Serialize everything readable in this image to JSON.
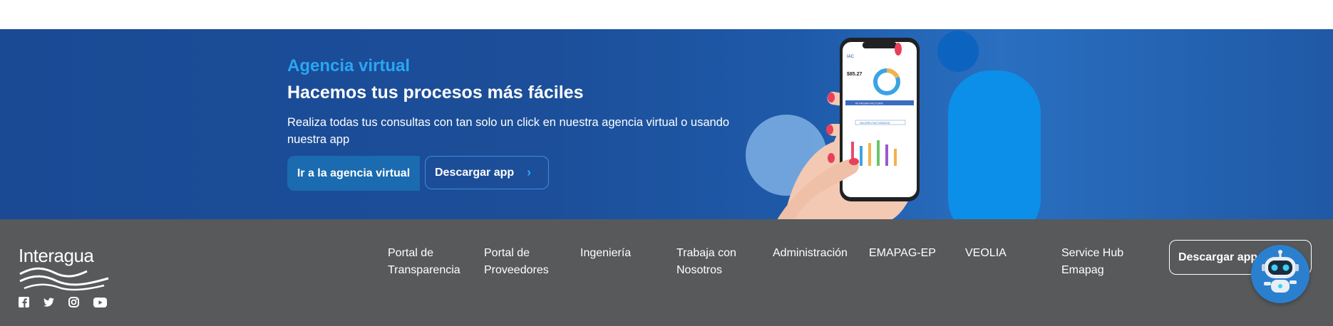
{
  "banner": {
    "eyebrow": "Agencia virtual",
    "headline": "Hacemos tus procesos más fáciles",
    "description": "Realiza todas tus consultas con tan solo un click en nuestra agencia virtual o usando nuestra app",
    "primary_button": "Ir a la agencia virtual",
    "secondary_button": "Descargar app",
    "secondary_icon": "chevron-right-icon",
    "phone": {
      "balance": "$85.27",
      "pay_button": "IR PAGAR FACTURA",
      "link": "VALORES FACTURADOS"
    }
  },
  "footer": {
    "logo_text": "Interagua",
    "social": [
      "facebook-icon",
      "twitter-icon",
      "instagram-icon",
      "youtube-icon"
    ],
    "links": [
      "Portal de Transparencia",
      "Portal de Proveedores",
      "Ingeniería",
      "Trabaja con Nosotros",
      "Administración",
      "EMAPAG-EP",
      "VEOLIA",
      "Service Hub Emapag"
    ],
    "download_button": "Descargar app"
  },
  "colors": {
    "banner_bg": "#1c4e99",
    "accent": "#2aa6f2",
    "footer_bg": "#58595b"
  }
}
